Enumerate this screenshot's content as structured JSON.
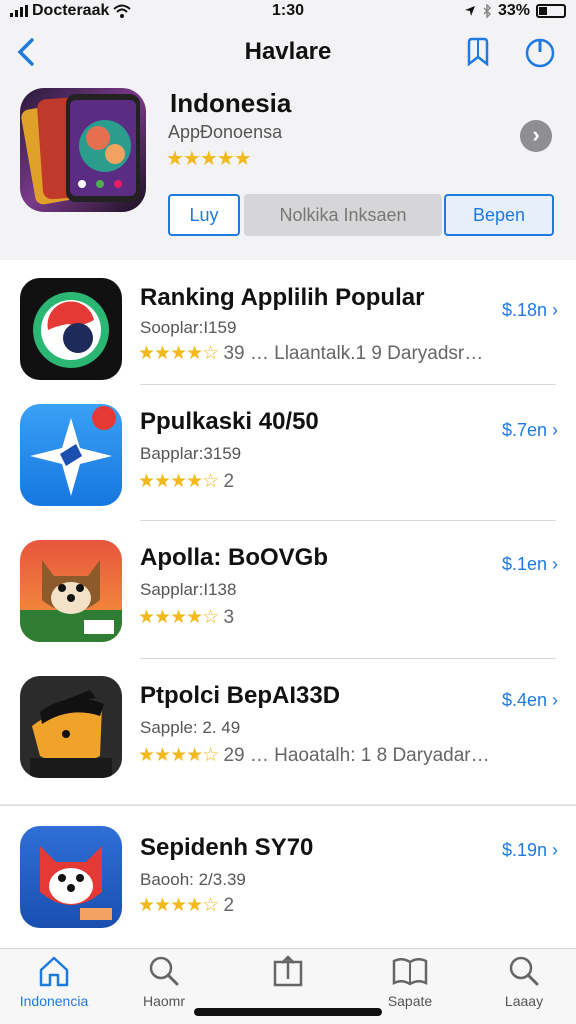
{
  "status_bar": {
    "carrier": "Docteraak",
    "time": "1:30",
    "battery": "33%"
  },
  "nav": {
    "title": "Havlare",
    "back_icon": "chevron-left-icon",
    "bookmark_icon": "bookmark-icon",
    "power_icon": "power-icon"
  },
  "hero": {
    "title": "Indonesia",
    "subtitle": "AppÐonoensa",
    "stars": "★★★★★",
    "segments": [
      "Luy",
      "Nolkika Inksaen",
      "Bepen"
    ]
  },
  "apps": [
    {
      "title": "Ranking Applilih Popular",
      "subtitle": "Sooplar:I159",
      "stars": "★★★★☆",
      "rating_text": "39  … Llaantalk.1 9 Daryadsr…",
      "price": "$.18n"
    },
    {
      "title": "Ppulkaski 40/50",
      "subtitle": "Bapplar:3159",
      "stars": "★★★★☆",
      "rating_text": "2",
      "price": "$.7en"
    },
    {
      "title": "Apolla: BoOVGb",
      "subtitle": "Sapplar:I138",
      "stars": "★★★★☆",
      "rating_text": "3",
      "price": "$.1en"
    },
    {
      "title": "Ptpolci BepAI33D",
      "subtitle": "Sapple: 2. 49",
      "stars": "★★★★☆",
      "rating_text": "29  … Haoatalh: 1 8 Daryadar…",
      "price": "$.4en"
    },
    {
      "title": "Sepidenh SY70",
      "subtitle": "Baooh: 2/3.39",
      "stars": "★★★★☆",
      "rating_text": "2",
      "price": "$.19n"
    }
  ],
  "tabs": [
    {
      "label": "Indonencia",
      "icon": "home-icon"
    },
    {
      "label": "Haomr",
      "icon": "search-icon"
    },
    {
      "label": "",
      "icon": "share-box-icon"
    },
    {
      "label": "Sapate",
      "icon": "book-icon"
    },
    {
      "label": "Laaay",
      "icon": "search-icon"
    }
  ],
  "colors": {
    "accent": "#1f7ae0",
    "star": "#f2b91d"
  }
}
